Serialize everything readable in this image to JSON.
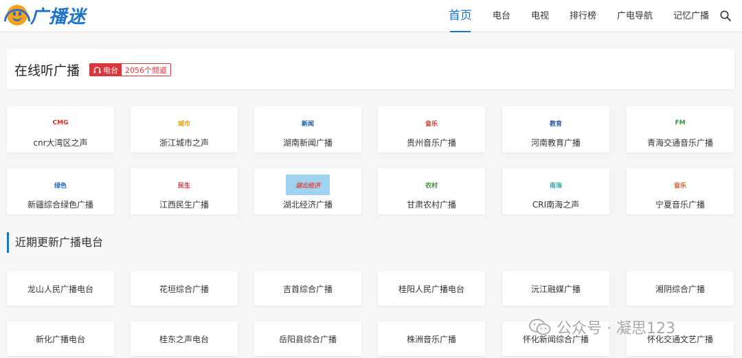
{
  "header": {
    "logo_text": "广播迷",
    "nav": [
      {
        "label": "首页",
        "active": true
      },
      {
        "label": "电台",
        "active": false
      },
      {
        "label": "电视",
        "active": false
      },
      {
        "label": "排行榜",
        "active": false
      },
      {
        "label": "广电导航",
        "active": false
      },
      {
        "label": "记忆广播",
        "active": false
      }
    ]
  },
  "banner": {
    "title": "在线听广播",
    "badge_label": "电台",
    "badge_count": "2056个频道"
  },
  "stations": [
    {
      "name": "cnr大湾区之声",
      "logo": "CMG",
      "logo_color": "#d52b2b"
    },
    {
      "name": "浙江城市之声",
      "logo": "城市",
      "logo_color": "#e8a316"
    },
    {
      "name": "湖南新闻广播",
      "logo": "新闻",
      "logo_color": "#1b5fae"
    },
    {
      "name": "贵州音乐广播",
      "logo": "音乐",
      "logo_color": "#c8362c"
    },
    {
      "name": "河南教育广播",
      "logo": "教育",
      "logo_color": "#2a5aa8"
    },
    {
      "name": "青海交通音乐广播",
      "logo": "FM",
      "logo_color": "#2f9a3c"
    },
    {
      "name": "新疆综合绿色广播",
      "logo": "绿色",
      "logo_color": "#1a6fc2"
    },
    {
      "name": "江西民生广播",
      "logo": "民生",
      "logo_color": "#d23c3c"
    },
    {
      "name": "湖北经济广播",
      "logo": "湖北经济",
      "logo_color": "#e24a4a"
    },
    {
      "name": "甘肃农村广播",
      "logo": "农村",
      "logo_color": "#3c8c3a"
    },
    {
      "name": "CRI南海之声",
      "logo": "南海",
      "logo_color": "#3aa9b8"
    },
    {
      "name": "宁夏音乐广播",
      "logo": "音乐",
      "logo_color": "#e05a2a"
    }
  ],
  "recent": {
    "title": "近期更新广播电台",
    "items": [
      "龙山人民广播电台",
      "花垣综合广播",
      "吉首综合广播",
      "桂阳人民广播电台",
      "沅江融媒广播",
      "湘阴综合广播",
      "新化广播电台",
      "桂东之声电台",
      "岳阳县综合广播",
      "株洲音乐广播",
      "怀化新闻综合广播",
      "怀化交通文艺广播"
    ]
  },
  "watermark": "公众号 · 凝思123"
}
